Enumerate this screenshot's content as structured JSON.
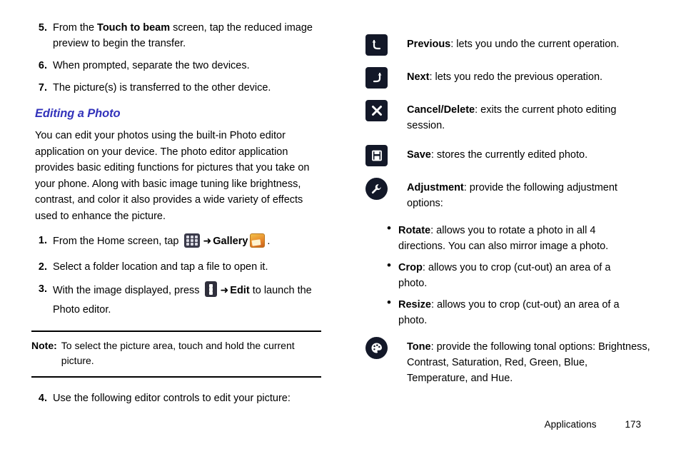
{
  "left": {
    "steps_top": [
      {
        "num": "5.",
        "html": "From the <b>Touch to beam</b> screen, tap the reduced image preview to begin the transfer."
      },
      {
        "num": "6.",
        "html": "When prompted, separate the two devices."
      },
      {
        "num": "7.",
        "html": "The picture(s) is transferred to the other device."
      }
    ],
    "section_title": "Editing a Photo",
    "paragraph": "You can edit your photos using the built-in Photo editor application on your device. The photo editor application provides basic editing functions for pictures that you take on your phone. Along with basic image tuning like brightness, contrast, and color it also provides a wide variety of effects used to enhance the picture.",
    "steps_mid": [
      {
        "num": "1.",
        "prefix": "From the Home screen, tap ",
        "icon1": "apps-grid-icon",
        "arrow": "➜",
        "bold": "Gallery",
        "icon2": "gallery-icon",
        "suffix": "."
      },
      {
        "num": "2.",
        "text": "Select a folder location and tap a file to open it."
      },
      {
        "num": "3.",
        "prefix": "With the image displayed, press ",
        "icon1": "overflow-menu-icon",
        "arrow": "➜",
        "bold": "Edit",
        "suffix": " to launch the Photo editor."
      }
    ],
    "note": {
      "label": "Note:",
      "text": "To select the picture area, touch and hold the current picture."
    },
    "step_after_note": {
      "num": "4.",
      "text": "Use the following editor controls to edit your picture:"
    }
  },
  "right": {
    "controls": [
      {
        "icon": "undo-arrow-icon",
        "shape": "square",
        "glyph": "↶",
        "title": "Previous",
        "desc": ": lets you undo the current operation."
      },
      {
        "icon": "redo-arrow-icon",
        "shape": "square",
        "glyph": "↷",
        "title": "Next",
        "desc": ": lets you redo the previous operation."
      },
      {
        "icon": "close-x-icon",
        "shape": "square",
        "glyph": "✕",
        "title": "Cancel/Delete",
        "desc": ": exits the current photo editing session."
      },
      {
        "icon": "save-floppy-icon",
        "shape": "square",
        "glyph": "▤",
        "title": "Save",
        "desc": ": stores the currently edited photo."
      },
      {
        "icon": "adjustment-wrench-icon",
        "shape": "circle",
        "glyph": "⚒",
        "title": "Adjustment",
        "desc": ": provide the following adjustment options:"
      }
    ],
    "adjustment_bullets": [
      {
        "bold": "Rotate",
        "text": ": allows you to rotate a photo in all 4 directions. You can also mirror image a photo."
      },
      {
        "bold": "Crop",
        "text": ": allows you to crop (cut-out) an area of a photo."
      },
      {
        "bold": "Resize",
        "text": ": allows you to crop (cut-out) an area of a photo."
      }
    ],
    "tone": {
      "icon": "tone-palette-icon",
      "shape": "circle",
      "glyph": "◐",
      "title": "Tone",
      "desc": ": provide the following tonal options: Brightness, Contrast, Saturation, Red, Green, Blue, Temperature, and Hue."
    }
  },
  "footer": {
    "section": "Applications",
    "page": "173"
  }
}
